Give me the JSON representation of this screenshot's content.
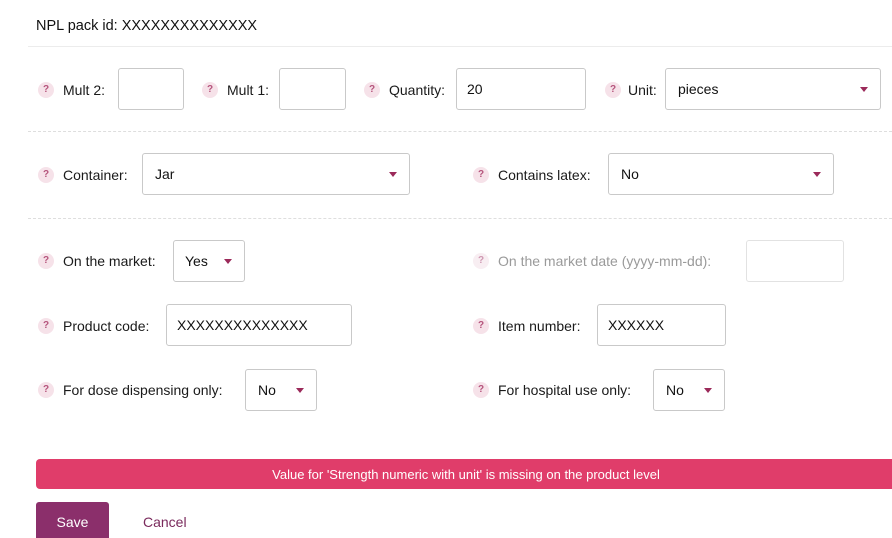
{
  "header": {
    "npl_pack_id_text": "NPL pack id: XXXXXXXXXXXXXX"
  },
  "help_glyph": "?",
  "row1": {
    "mult2": {
      "label": "Mult 2:",
      "value": ""
    },
    "mult1": {
      "label": "Mult 1:",
      "value": ""
    },
    "quantity": {
      "label": "Quantity:",
      "value": "20"
    },
    "unit": {
      "label": "Unit:",
      "selected": "pieces"
    }
  },
  "row2": {
    "container": {
      "label": "Container:",
      "selected": "Jar"
    },
    "contains_latex": {
      "label": "Contains latex:",
      "selected": "No"
    }
  },
  "row3": {
    "on_market": {
      "label": "On the market:",
      "selected": "Yes"
    },
    "market_date": {
      "label": "On the market date (yyyy-mm-dd):",
      "value": ""
    }
  },
  "row4": {
    "product_code": {
      "label": "Product code:",
      "value": "XXXXXXXXXXXXXX"
    },
    "item_number": {
      "label": "Item number:",
      "value": "XXXXXX"
    }
  },
  "row5": {
    "dose_dispensing": {
      "label": "For dose dispensing only:",
      "selected": "No"
    },
    "hospital_use": {
      "label": "For hospital use only:",
      "selected": "No"
    }
  },
  "error": {
    "message": "Value for 'Strength numeric with unit' is missing on the product level"
  },
  "actions": {
    "save_label": "Save",
    "cancel_label": "Cancel"
  },
  "colors": {
    "accent": "#8b2f6b",
    "error": "#e03d6a",
    "help_bg": "#f6e2e9",
    "help_fg": "#b5547c",
    "caret": "#9b2a5a"
  }
}
